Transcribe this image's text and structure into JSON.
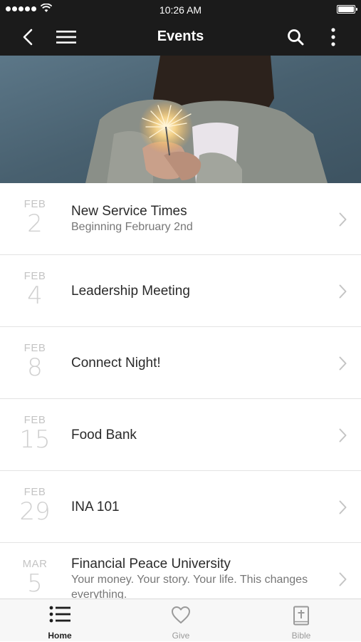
{
  "status_bar": {
    "time": "10:26 AM"
  },
  "nav": {
    "title": "Events"
  },
  "events": [
    {
      "month": "FEB",
      "day": "2",
      "title": "New Service Times",
      "subtitle": "Beginning February 2nd"
    },
    {
      "month": "FEB",
      "day": "4",
      "title": "Leadership Meeting",
      "subtitle": ""
    },
    {
      "month": "FEB",
      "day": "8",
      "title": "Connect Night!",
      "subtitle": ""
    },
    {
      "month": "FEB",
      "day": "15",
      "title": "Food Bank",
      "subtitle": ""
    },
    {
      "month": "FEB",
      "day": "29",
      "title": "INA 101",
      "subtitle": ""
    },
    {
      "month": "MAR",
      "day": "5",
      "title": "Financial Peace University",
      "subtitle": "Your money. Your story. Your life. This changes everything."
    }
  ],
  "tabs": [
    {
      "label": "Home",
      "icon": "list-icon",
      "active": true
    },
    {
      "label": "Give",
      "icon": "heart-icon",
      "active": false
    },
    {
      "label": "Bible",
      "icon": "bible-icon",
      "active": false
    }
  ],
  "colors": {
    "header": "#1b1b1b",
    "divider": "#e3e3e3",
    "date": "#c4c4c4"
  }
}
